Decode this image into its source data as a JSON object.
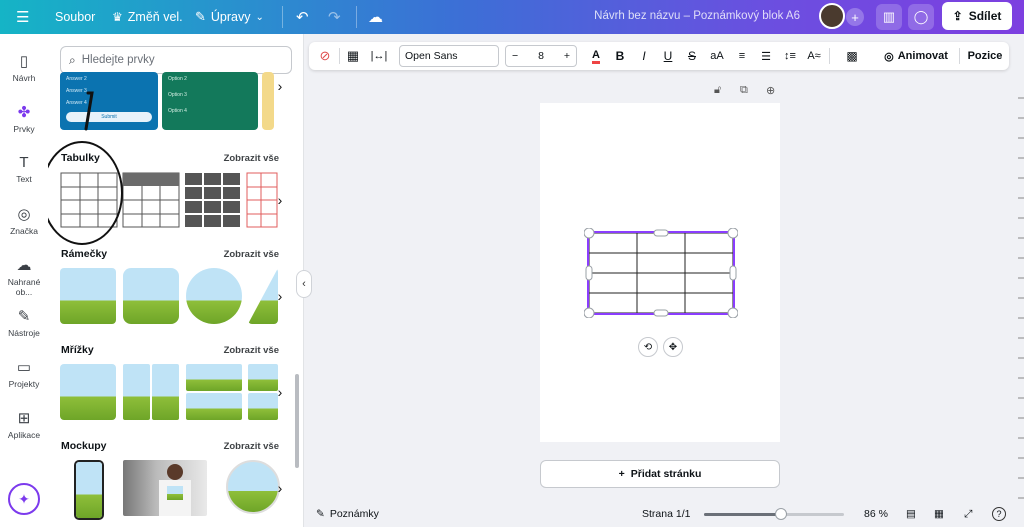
{
  "topbar": {
    "menu_icon": "hamburger-icon",
    "file": "Soubor",
    "resize": "Změň vel.",
    "edit": "Úpravy",
    "title": "Návrh bez názvu – Poznámkový blok A6",
    "share": "Sdílet"
  },
  "rail": [
    {
      "label": "Návrh",
      "icon": "layout-icon",
      "glyph": "▯"
    },
    {
      "label": "Prvky",
      "icon": "shapes-icon",
      "glyph": "✤"
    },
    {
      "label": "Text",
      "icon": "text-icon",
      "glyph": "T"
    },
    {
      "label": "Značka",
      "icon": "brand-icon",
      "glyph": "◎"
    },
    {
      "label": "Nahrané ob...",
      "icon": "upload-icon",
      "glyph": "☁"
    },
    {
      "label": "Nástroje",
      "icon": "tools-icon",
      "glyph": "✎"
    },
    {
      "label": "Projekty",
      "icon": "folder-icon",
      "glyph": "▭"
    },
    {
      "label": "Aplikace",
      "icon": "apps-icon",
      "glyph": "⊞"
    }
  ],
  "panel": {
    "search_placeholder": "Hledejte prvky",
    "form_items": [
      "Answer 2",
      "Answer 3",
      "Answer 4"
    ],
    "form_submit": "Submit",
    "form_options": [
      "Option 2",
      "Option 3",
      "Option 4"
    ],
    "sections": [
      {
        "title": "Tabulky",
        "link": "Zobrazit vše"
      },
      {
        "title": "Rámečky",
        "link": "Zobrazit vše"
      },
      {
        "title": "Mřížky",
        "link": "Zobrazit vše"
      },
      {
        "title": "Mockupy",
        "link": "Zobrazit vše"
      }
    ],
    "annotation": "1"
  },
  "toolbar": {
    "font": "Open Sans",
    "size": "8",
    "size_minus": "−",
    "size_plus": "+",
    "text_color": "A",
    "bold": "B",
    "italic": "I",
    "underline": "U",
    "strike": "S",
    "case": "aA",
    "animate": "Animovat",
    "position": "Pozice"
  },
  "canvas": {
    "add_page": "Přidat stránku",
    "table_rows": 4,
    "table_cols": 3
  },
  "bottom": {
    "notes": "Poznámky",
    "page": "Strana 1/1",
    "zoom": "86 %",
    "zoom_value": 0.55
  },
  "colors": {
    "accent": "#7c3aed",
    "selection": "#8b3dff"
  }
}
